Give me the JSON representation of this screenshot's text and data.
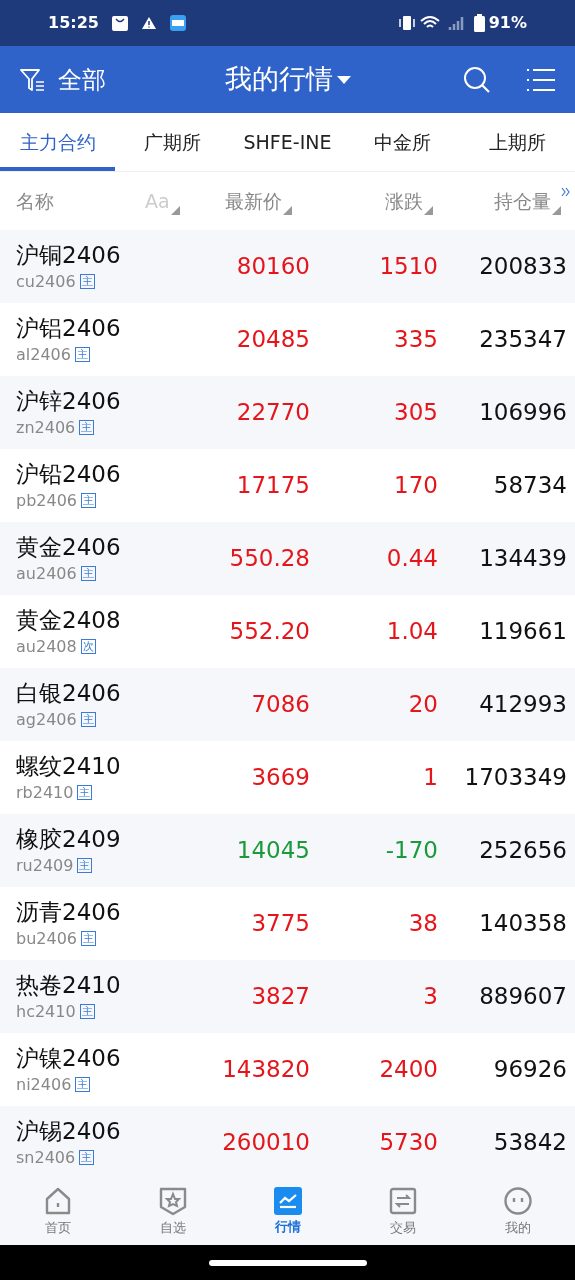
{
  "status_bar": {
    "time": "15:25",
    "battery": "91%"
  },
  "header": {
    "filter_label": "全部",
    "title": "我的行情"
  },
  "tabs": [
    {
      "label": "主力合约",
      "selected": true
    },
    {
      "label": "广期所",
      "selected": false
    },
    {
      "label": "SHFE-INE",
      "selected": false
    },
    {
      "label": "中金所",
      "selected": false
    },
    {
      "label": "上期所",
      "selected": false
    }
  ],
  "columns": [
    "名称",
    "Aa",
    "最新价",
    "涨跌",
    "持仓量"
  ],
  "rows": [
    {
      "name": "沪铜2406",
      "code": "cu2406",
      "badge": "主",
      "price": "80160",
      "change": "1510",
      "open_interest": "200833",
      "color": "#e5161b"
    },
    {
      "name": "沪铝2406",
      "code": "al2406",
      "badge": "主",
      "price": "20485",
      "change": "335",
      "open_interest": "235347",
      "color": "#e5161b"
    },
    {
      "name": "沪锌2406",
      "code": "zn2406",
      "badge": "主",
      "price": "22770",
      "change": "305",
      "open_interest": "106996",
      "color": "#e5161b"
    },
    {
      "name": "沪铅2406",
      "code": "pb2406",
      "badge": "主",
      "price": "17175",
      "change": "170",
      "open_interest": "58734",
      "color": "#e5161b"
    },
    {
      "name": "黄金2406",
      "code": "au2406",
      "badge": "主",
      "price": "550.28",
      "change": "0.44",
      "open_interest": "134439",
      "color": "#e5161b"
    },
    {
      "name": "黄金2408",
      "code": "au2408",
      "badge": "次",
      "price": "552.20",
      "change": "1.04",
      "open_interest": "119661",
      "color": "#e5161b"
    },
    {
      "name": "白银2406",
      "code": "ag2406",
      "badge": "主",
      "price": "7086",
      "change": "20",
      "open_interest": "412993",
      "color": "#e5161b"
    },
    {
      "name": "螺纹2410",
      "code": "rb2410",
      "badge": "主",
      "price": "3669",
      "change": "1",
      "open_interest": "1703349",
      "color": "#e5161b"
    },
    {
      "name": "橡胶2409",
      "code": "ru2409",
      "badge": "主",
      "price": "14045",
      "change": "-170",
      "open_interest": "252656",
      "color": "#1a9a3a"
    },
    {
      "name": "沥青2406",
      "code": "bu2406",
      "badge": "主",
      "price": "3775",
      "change": "38",
      "open_interest": "140358",
      "color": "#e5161b"
    },
    {
      "name": "热卷2410",
      "code": "hc2410",
      "badge": "主",
      "price": "3827",
      "change": "3",
      "open_interest": "889607",
      "color": "#e5161b"
    },
    {
      "name": "沪镍2406",
      "code": "ni2406",
      "badge": "主",
      "price": "143820",
      "change": "2400",
      "open_interest": "96926",
      "color": "#e5161b"
    },
    {
      "name": "沪锡2406",
      "code": "sn2406",
      "badge": "主",
      "price": "260010",
      "change": "5730",
      "open_interest": "53842",
      "color": "#e5161b"
    }
  ],
  "bottom_nav": [
    {
      "label": "首页",
      "kind": "home",
      "selected": false
    },
    {
      "label": "自选",
      "kind": "star",
      "selected": false
    },
    {
      "label": "行情",
      "kind": "chart",
      "selected": true
    },
    {
      "label": "交易",
      "kind": "swap",
      "selected": false
    },
    {
      "label": "我的",
      "kind": "face",
      "selected": false
    }
  ]
}
